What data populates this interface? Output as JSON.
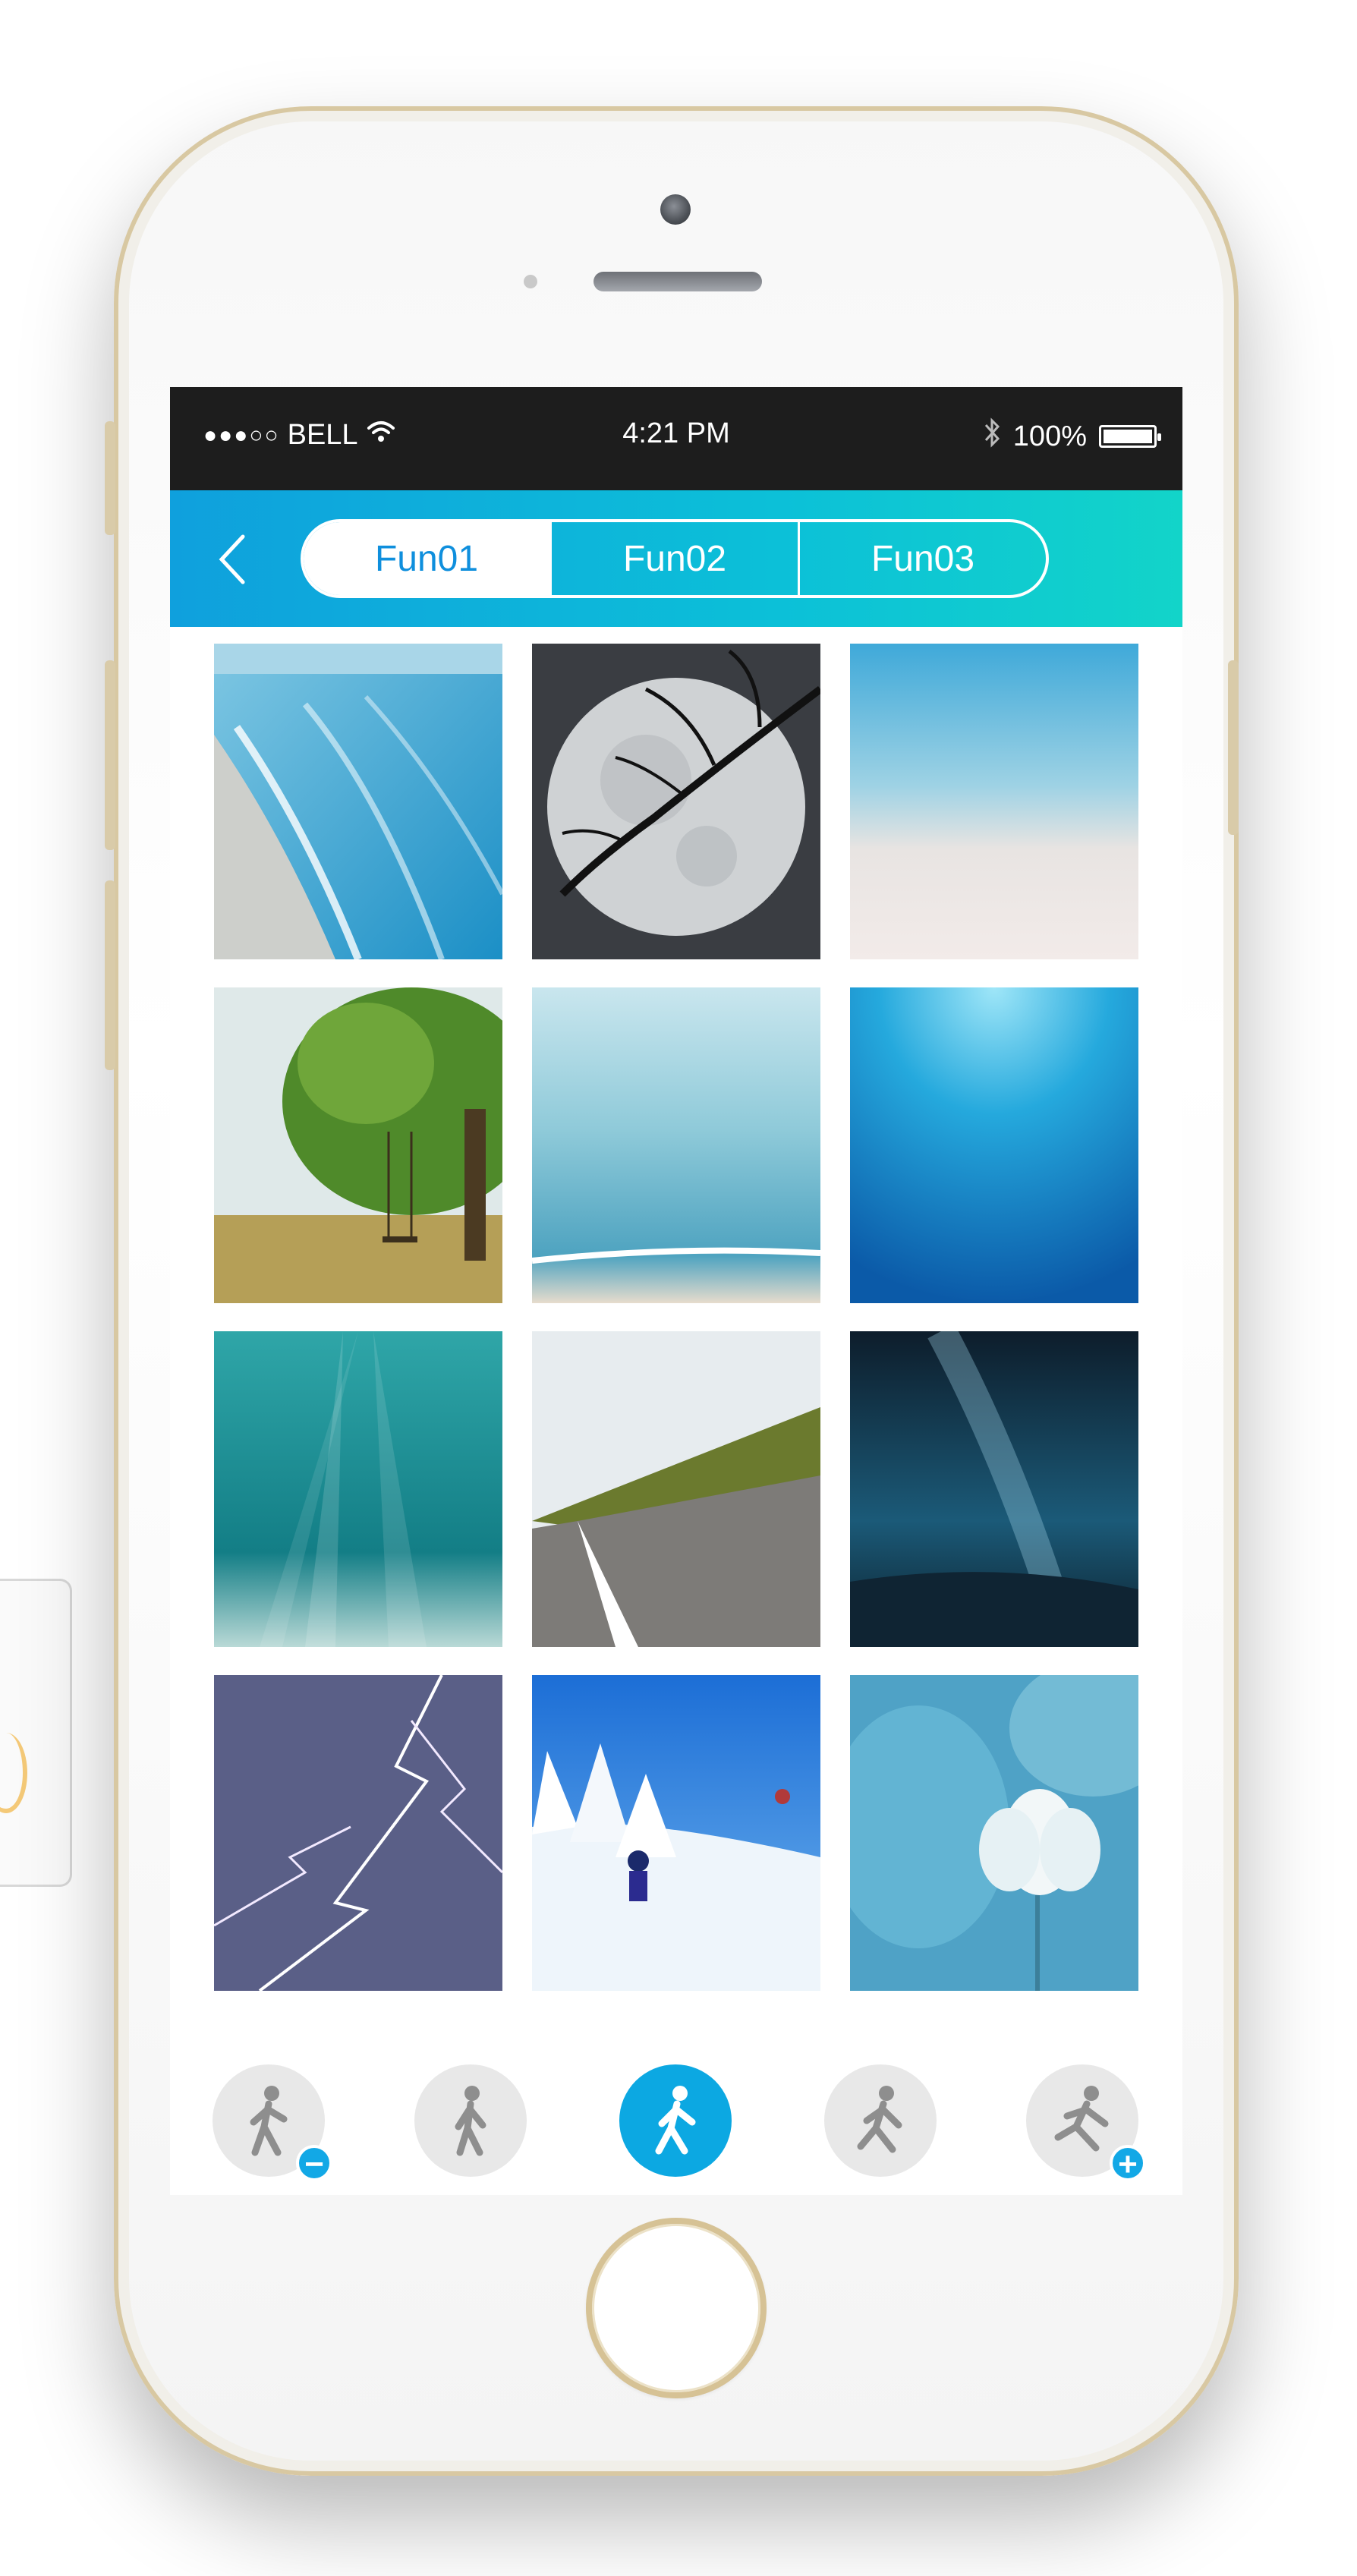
{
  "status_bar": {
    "signal_dots": "●●●○○",
    "carrier": "BELL",
    "wifi_icon": "wifi-icon",
    "time": "4:21 PM",
    "bluetooth_icon": "bluetooth-icon",
    "battery": "100%",
    "battery_level": 1.0
  },
  "nav": {
    "back_icon": "chevron-left-icon",
    "tabs": [
      {
        "label": "Fun01",
        "active": true
      },
      {
        "label": "Fun02",
        "active": false
      },
      {
        "label": "Fun03",
        "active": false
      }
    ]
  },
  "gallery": {
    "tiles": [
      "beach-shore",
      "moon-tree",
      "pale-sea",
      "tree-swing",
      "calm-sea",
      "underwater-blue",
      "underwater-rays",
      "road-speed",
      "milky-way",
      "lightning",
      "skier",
      "lotus"
    ]
  },
  "speed_modes": [
    {
      "icon": "walk-slow-icon",
      "badge": "−",
      "active": false
    },
    {
      "icon": "walk-icon",
      "badge": "",
      "active": false
    },
    {
      "icon": "walk-active-icon",
      "badge": "",
      "active": true
    },
    {
      "icon": "jog-icon",
      "badge": "",
      "active": false
    },
    {
      "icon": "run-fast-icon",
      "badge": "+",
      "active": false
    }
  ],
  "colors": {
    "nav_gradient_start": "#0fa0dd",
    "nav_gradient_end": "#12d4c9",
    "active_mode": "#0ca8e2",
    "status_bar": "#1d1d1d"
  }
}
